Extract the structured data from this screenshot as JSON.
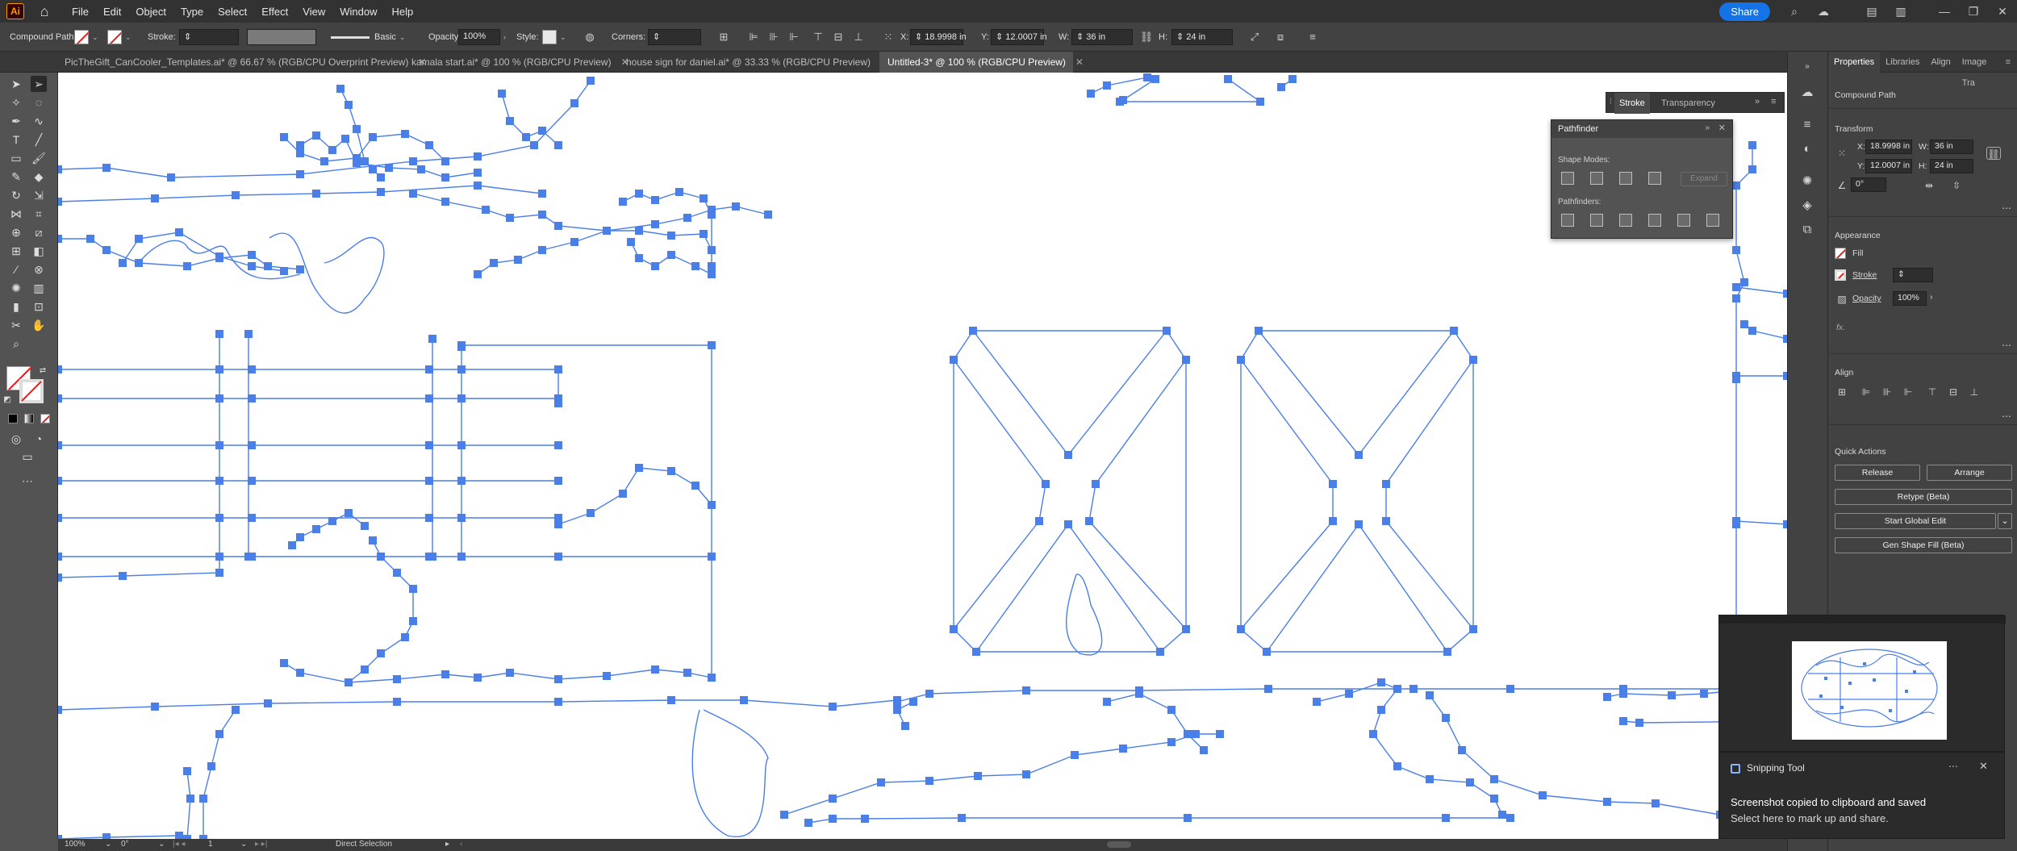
{
  "menubar": {
    "logo": "Ai",
    "items": [
      "File",
      "Edit",
      "Object",
      "Type",
      "Select",
      "Effect",
      "View",
      "Window",
      "Help"
    ],
    "share_label": "Share"
  },
  "controlbar": {
    "selection_type": "Compound Path",
    "stroke_label": "Stroke:",
    "brush_name": "Basic",
    "opacity_label": "Opacity:",
    "opacity_value": "100%",
    "style_label": "Style:",
    "corners_label": "Corners:",
    "x_label": "X:",
    "x_value": "18.9998 in",
    "y_label": "Y:",
    "y_value": "12.0007 in",
    "w_label": "W:",
    "w_value": "36 in",
    "h_label": "H:",
    "h_value": "24 in"
  },
  "tabs": [
    {
      "label": "PicTheGift_CanCooler_Templates.ai* @ 66.67 % (RGB/CPU Overprint Preview)"
    },
    {
      "label": "kamala start.ai* @ 100 % (RGB/CPU Preview)"
    },
    {
      "label": "house sign for daniel.ai* @ 33.33 % (RGB/CPU Preview)"
    },
    {
      "label": "Untitled-3* @ 100 % (RGB/CPU Preview)"
    }
  ],
  "stroke_panel": {
    "tab1": "Stroke",
    "tab2": "Transparency"
  },
  "pathfinder": {
    "title": "Pathfinder",
    "shape_modes": "Shape Modes:",
    "expand": "Expand",
    "pathfinders": "Pathfinders:"
  },
  "properties": {
    "tabs": [
      "Properties",
      "Libraries",
      "Align",
      "Image Tra"
    ],
    "selection": "Compound Path",
    "transform_title": "Transform",
    "x_label": "X:",
    "x_value": "18.9998 in",
    "y_label": "Y:",
    "y_value": "12.0007 in",
    "w_label": "W:",
    "w_value": "36 in",
    "h_label": "H:",
    "h_value": "24 in",
    "angle_value": "0°",
    "appearance_title": "Appearance",
    "fill_label": "Fill",
    "stroke_label": "Stroke",
    "opacity_label": "Opacity",
    "opacity_value": "100%",
    "fx_label": "fx.",
    "align_title": "Align",
    "quick_actions_title": "Quick Actions",
    "release": "Release",
    "arrange": "Arrange",
    "retype": "Retype (Beta)",
    "global_edit": "Start Global Edit",
    "gen_shape_fill": "Gen Shape Fill (Beta)"
  },
  "statusbar": {
    "zoom": "100%",
    "rotation": "0°",
    "artboard": "1",
    "tool": "Direct Selection"
  },
  "snipping": {
    "app_name": "Snipping Tool",
    "title": "Screenshot copied to clipboard and saved",
    "body": "Select here to mark up and share."
  },
  "colors": {
    "path_blue": "#4a7ee8",
    "accent": "#1473e6"
  }
}
